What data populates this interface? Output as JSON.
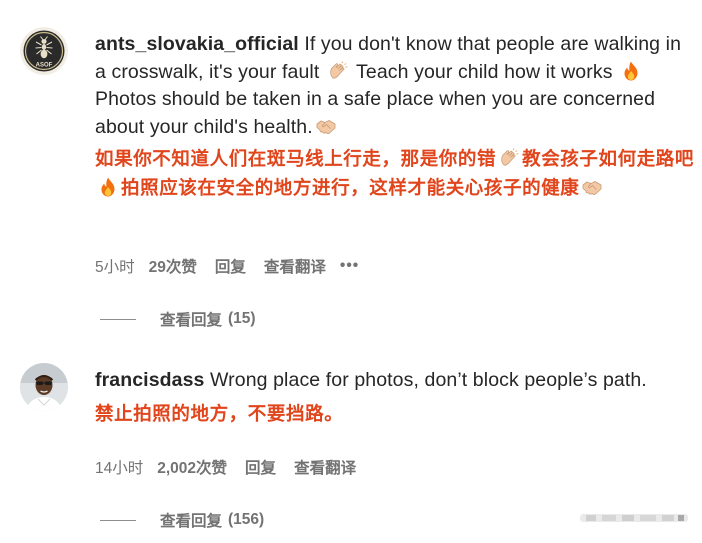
{
  "comments": [
    {
      "username": "ants_slovakia_official",
      "text_1": " If you don't know that people are walking in a crosswalk, it's your fault ",
      "text_2": " Teach your child how it works ",
      "text_3": " Photos should be taken in a safe place when you are concerned about your child's health.",
      "translation_1": "如果你不知道人们在斑马线上行走，那是你的错",
      "translation_2": "教会孩子如何走路吧",
      "translation_3": "拍照应该在安全的地方进行，这样才能关心孩子的健康",
      "avatar_text": "ASOF",
      "time": "5小时",
      "likes": "29次赞",
      "reply_label": "回复",
      "translate_label": "查看翻译",
      "more_label": "•••",
      "view_replies_label": "查看回复",
      "view_replies_count": "(15)"
    },
    {
      "username": "francisdass",
      "text_1": " Wrong place for photos, don’t block people’s path.",
      "translation_1": "禁止拍照的地方，不要挡路。",
      "time": "14小时",
      "likes": "2,002次赞",
      "reply_label": "回复",
      "translate_label": "查看翻译",
      "view_replies_label": "查看回复",
      "view_replies_count": "(156)"
    }
  ],
  "colors": {
    "translation_text": "#e0451c",
    "meta_text": "#737373",
    "body_text": "#262626"
  },
  "icons": [
    "clapping-hands-icon",
    "fire-icon",
    "handshake-icon",
    "more-dots-icon"
  ]
}
